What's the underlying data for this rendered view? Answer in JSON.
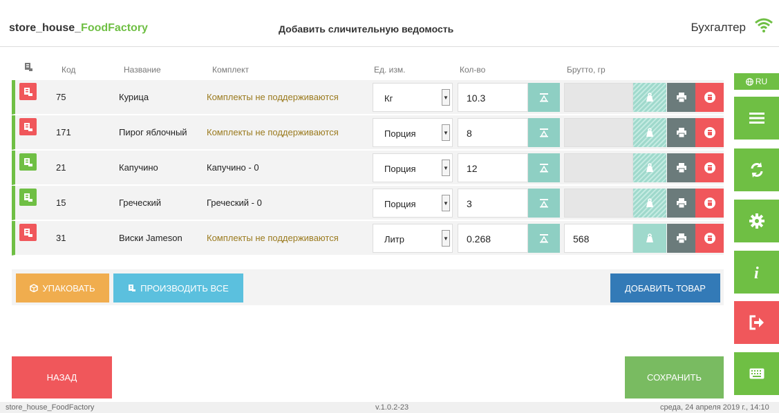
{
  "header": {
    "brand_prefix": "store_house_",
    "brand_accent": "FoodFactory",
    "title": "Добавить сличительную ведомость",
    "user": "Бухгалтер"
  },
  "table": {
    "columns": {
      "code": "Код",
      "name": "Название",
      "kit": "Комплект",
      "unit": "Ед. изм.",
      "qty": "Кол-во",
      "gross": "Брутто, гр"
    },
    "rows": [
      {
        "code": "75",
        "name": "Курица",
        "kit": "Комплекты не поддерживаются",
        "unit": "Кг",
        "qty": "10.3",
        "gross": "",
        "status": "red"
      },
      {
        "code": "171",
        "name": "Пирог яблочный",
        "kit": "Комплекты не поддерживаются",
        "unit": "Порция",
        "qty": "8",
        "gross": "",
        "status": "red"
      },
      {
        "code": "21",
        "name": "Капучино",
        "kit": "Капучино - 0",
        "unit": "Порция",
        "qty": "12",
        "gross": "",
        "status": "green"
      },
      {
        "code": "15",
        "name": "Греческий",
        "kit": "Греческий - 0",
        "unit": "Порция",
        "qty": "3",
        "gross": "",
        "status": "green"
      },
      {
        "code": "31",
        "name": "Виски Jameson",
        "kit": "Комплекты не поддерживаются",
        "unit": "Литр",
        "qty": "0.268",
        "gross": "568",
        "status": "red"
      }
    ]
  },
  "actions": {
    "pack": "УПАКОВАТЬ",
    "produce_all": "ПРОИЗВОДИТЬ ВСЕ",
    "add_item": "ДОБАВИТЬ ТОВАР",
    "back": "НАЗАД",
    "save": "СОХРАНИТЬ"
  },
  "sidebar": {
    "lang": "RU",
    "items": [
      "menu-icon",
      "sync-icon",
      "settings-icon",
      "info-icon",
      "logout-icon",
      "keyboard-icon"
    ]
  },
  "status": {
    "app": "store_house_FoodFactory",
    "version": "v.1.0.2-23",
    "datetime": "среда, 24 апреля 2019 г., 14:10"
  },
  "colors": {
    "green": "#6fbf44",
    "red": "#f0575b",
    "teal": "#8ecfc3",
    "blue": "#337ab7",
    "orange": "#f0ad4e",
    "cyan": "#5bc0de",
    "gray": "#6b7b7b"
  }
}
